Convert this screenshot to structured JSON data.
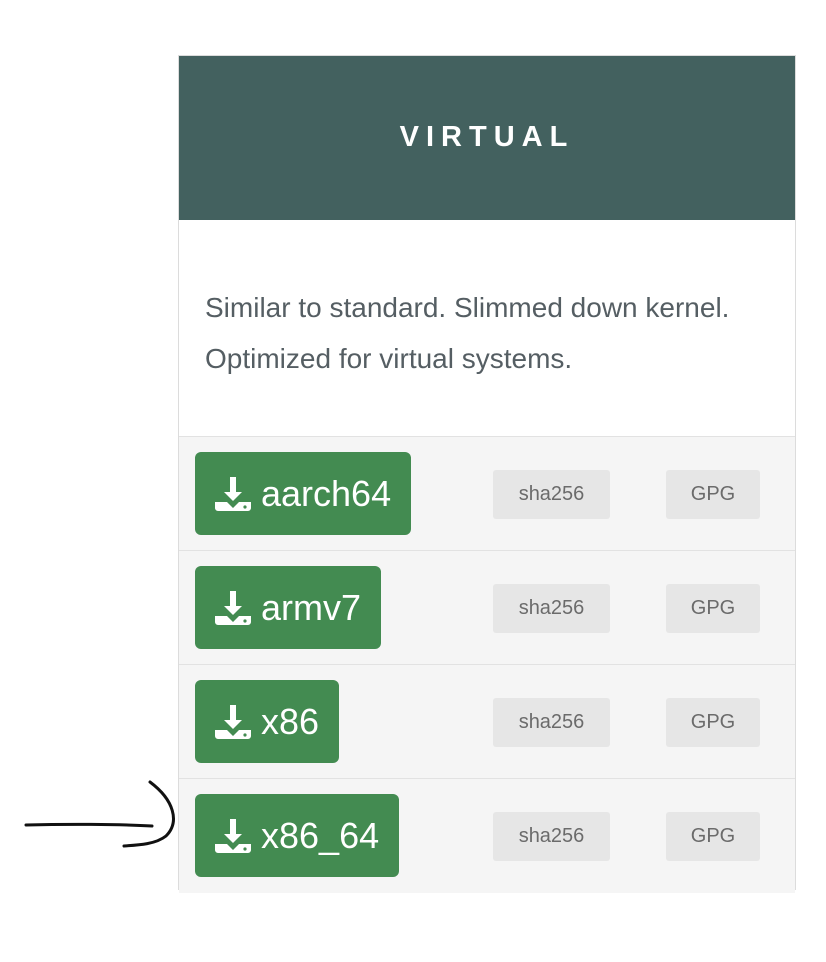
{
  "card": {
    "title": "VIRTUAL",
    "description": "Similar to standard. Slimmed down kernel. Optimized for virtual systems.",
    "header_color": "#43615f",
    "button_color": "#438b51",
    "downloads": [
      {
        "label": "aarch64",
        "sha_label": "sha256",
        "gpg_label": "GPG"
      },
      {
        "label": "armv7",
        "sha_label": "sha256",
        "gpg_label": "GPG"
      },
      {
        "label": "x86",
        "sha_label": "sha256",
        "gpg_label": "GPG"
      },
      {
        "label": "x86_64",
        "sha_label": "sha256",
        "gpg_label": "GPG"
      }
    ]
  },
  "annotation": {
    "icon": "hand-drawn-arrow-icon",
    "points_to": "x86_64"
  }
}
